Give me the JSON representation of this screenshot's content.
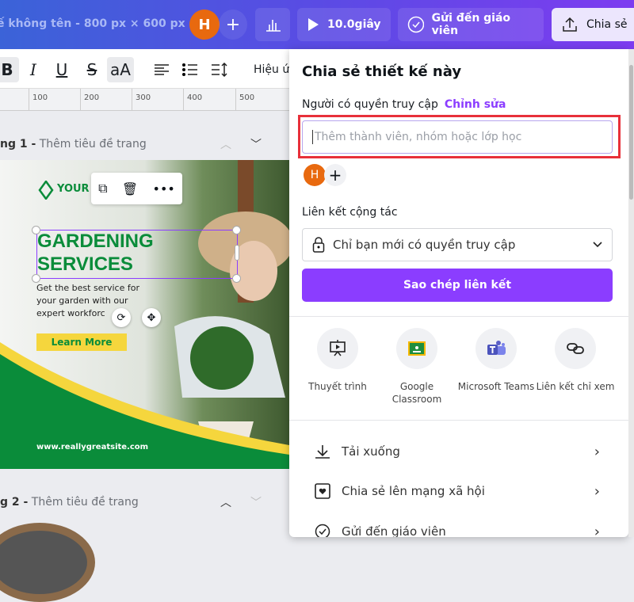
{
  "header": {
    "title": "ế không tên - 800 px × 600 px",
    "avatar": "H",
    "add": "+",
    "play_label": "10.0giây",
    "send_teacher": "Gửi đến giáo viên",
    "share": "Chia sẻ"
  },
  "toolbar": {
    "bold": "B",
    "italic": "I",
    "underline": "U",
    "strike": "S",
    "case": "aA",
    "effects": "Hiệu ứ"
  },
  "ruler": [
    "100",
    "200",
    "300",
    "400",
    "500"
  ],
  "pages": [
    {
      "number": "ng 1 -",
      "title": "Thêm tiêu đề trang"
    },
    {
      "number": "g 2 -",
      "title": "Thêm tiêu đề trang"
    }
  ],
  "design": {
    "logo": "YOUR",
    "headline1": "GARDENING",
    "headline2": "SERVICES",
    "body1": "Get the best service for",
    "body2": "your garden with our",
    "body3": "expert workforc",
    "cta": "Learn More",
    "url": "www.reallygreatsite.com"
  },
  "share_panel": {
    "title": "Chia sẻ thiết kế này",
    "access_label": "Người có quyền truy cập",
    "edit_link": "Chỉnh sửa",
    "input_placeholder": "Thêm thành viên, nhóm hoặc lớp học",
    "member_avatar": "H",
    "add_member": "+",
    "collab_label": "Liên kết cộng tác",
    "access_option": "Chỉ bạn mới có quyền truy cập",
    "copy_button": "Sao chép liên kết",
    "options": [
      {
        "label": "Thuyết trình",
        "icon": "present-icon"
      },
      {
        "label": "Google Classroom",
        "icon": "google-classroom-icon"
      },
      {
        "label": "Microsoft Teams",
        "icon": "teams-icon"
      },
      {
        "label": "Liên kết chỉ xem",
        "icon": "link-icon"
      }
    ],
    "rows": [
      {
        "label": "Tải xuống",
        "icon": "download-icon"
      },
      {
        "label": "Chia sẻ lên mạng xã hội",
        "icon": "social-icon"
      },
      {
        "label": "Gửi đến giáo viên",
        "icon": "check-circle-icon"
      }
    ]
  },
  "colors": {
    "accent": "#8b3dff",
    "highlight_box": "#e8303a",
    "green": "#0a8c3a",
    "yellow": "#f5d63d",
    "avatar": "#e8690f"
  }
}
